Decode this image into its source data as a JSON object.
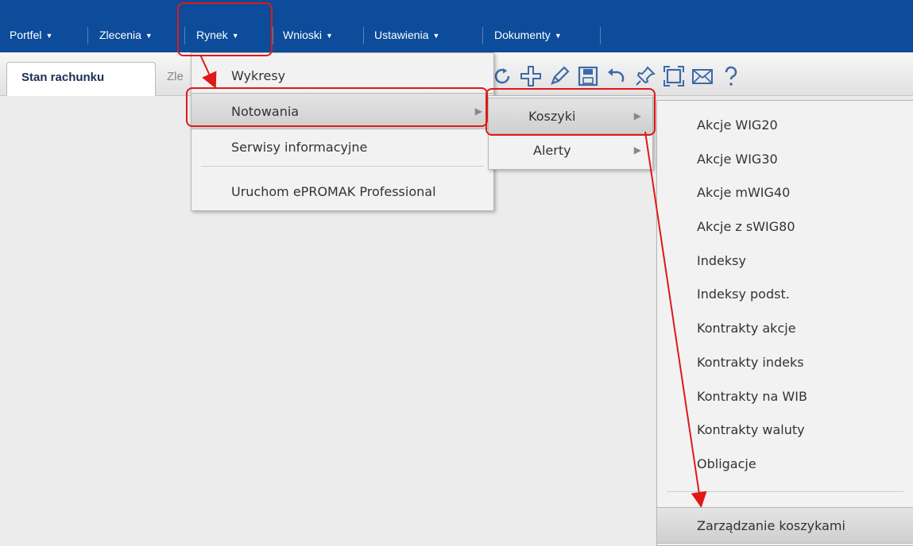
{
  "nav": {
    "items": [
      {
        "label": "Portfel"
      },
      {
        "label": "Zlecenia"
      },
      {
        "label": "Rynek"
      },
      {
        "label": "Wnioski"
      },
      {
        "label": "Ustawienia"
      },
      {
        "label": "Dokumenty"
      }
    ],
    "arrow": "▼"
  },
  "tabs": {
    "active": "Stan rachunku",
    "partial": "Zle"
  },
  "toolbar": {
    "icons": [
      "refresh-icon",
      "add-icon",
      "edit-icon",
      "save-icon",
      "undo-icon",
      "pin-icon",
      "fullscreen-icon",
      "mail-icon",
      "help-icon"
    ]
  },
  "menu_rynek": {
    "items": [
      "Wykresy",
      "Notowania",
      "Serwisy informacyjne",
      "Uruchom ePROMAK Professional"
    ],
    "selected": "Notowania"
  },
  "menu_notowania": {
    "items": [
      "Koszyki",
      "Alerty"
    ],
    "selected": "Koszyki"
  },
  "menu_koszyki": {
    "items": [
      "Akcje WIG20",
      "Akcje WIG30",
      "Akcje mWIG40",
      "Akcje z sWIG80",
      "Indeksy",
      "Indeksy podst.",
      "Kontrakty akcje",
      "Kontrakty indeks",
      "Kontrakty na WIB",
      "Kontrakty waluty",
      "Obligacje",
      "Zarządzanie koszykami"
    ],
    "highlighted": "Zarządzanie koszykami"
  },
  "colors": {
    "nav_bg": "#0d4c9a",
    "annotation": "#e01818"
  }
}
